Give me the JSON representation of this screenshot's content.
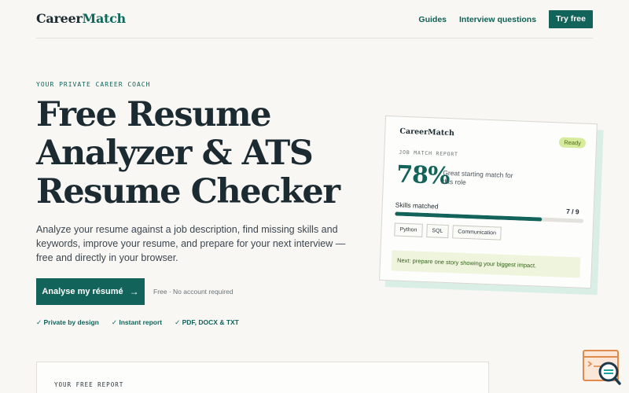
{
  "brand": {
    "part1": "Career",
    "part2": "Match"
  },
  "nav": {
    "guides": "Guides",
    "interview": "Interview questions",
    "try_free": "Try free"
  },
  "hero": {
    "eyebrow": "YOUR PRIVATE CAREER COACH",
    "title_lines": [
      "Free Resume",
      "Analyzer & ATS",
      "Resume Checker"
    ],
    "description": "Analyze your resume against a job description, find missing skills and keywords, improve your resume, and prepare for your next interview — free and directly in your browser.",
    "cta": "Analyse my résumé",
    "cta_note": "Free · No account required",
    "features": [
      "✓ Private by design",
      "✓ Instant report",
      "✓ PDF, DOCX & TXT"
    ]
  },
  "report_card": {
    "logo": "CareerMatch",
    "status": "Ready",
    "label": "JOB MATCH REPORT",
    "score": "78%",
    "score_note": "Great starting match for this role",
    "skills_label": "Skills matched",
    "skills_count": "7 / 9",
    "skills_fraction": 0.78,
    "chips": [
      "Python",
      "SQL",
      "Communication"
    ],
    "next_tip": "Next: prepare one story showing your biggest impact."
  },
  "report_section": {
    "label": "YOUR FREE REPORT"
  },
  "colors": {
    "accent": "#12635a",
    "background": "#f8f7f3",
    "badge": "#d6eb9c"
  },
  "icons": {
    "floating": "search-document-icon"
  }
}
